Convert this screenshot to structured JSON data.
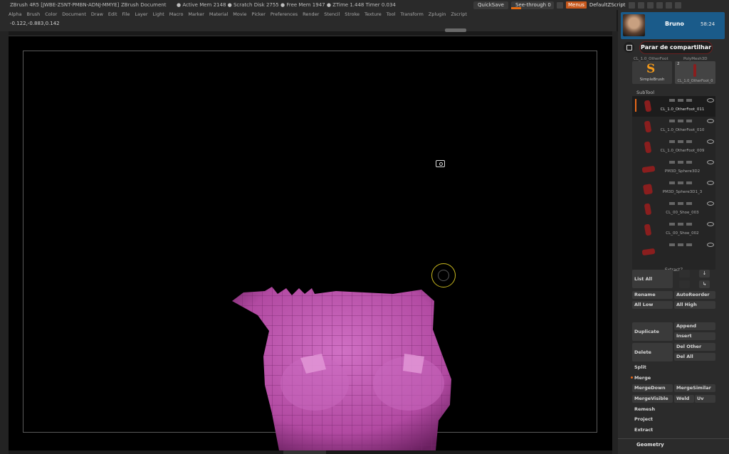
{
  "title_bar": {
    "app": "ZBrush 4R5 [JWBE-ZSNT-PMBN-ADNJ-MMYE]",
    "document": "ZBrush Document",
    "stats": "● Active Mem 2148 ● Scratch Disk 2755 ● Free Mem 1947 ● ZTime 1.448 Timer 0.034",
    "quicksave": "QuickSave",
    "see_through": "See-through",
    "see_through_value": "0",
    "menus": "Menus",
    "script": "DefaultZScript"
  },
  "menu_bar": {
    "items": [
      "Alpha",
      "Brush",
      "Color",
      "Document",
      "Draw",
      "Edit",
      "File",
      "Layer",
      "Light",
      "Macro",
      "Marker",
      "Material",
      "Movie",
      "Picker",
      "Preferences",
      "Render",
      "Stencil",
      "Stroke",
      "Texture",
      "Tool",
      "Transform",
      "Zplugin",
      "Zscript"
    ]
  },
  "coords": "-0.122,-0.883,0.142",
  "user": {
    "name": "Bruno",
    "time": "58:24"
  },
  "share_button": "Parar de compartilhar",
  "brushes": {
    "label_1": "CL_1.0_OtherFoot",
    "label_2": "PolyMesh3D",
    "simple_brush": "SimpleBrush",
    "brush2_count": "2",
    "brush2_name": "CL_1.0_OtherFoot_0"
  },
  "subtool": {
    "header": "SubTool",
    "items": [
      {
        "label": "CL_1.0_OtherFoot_011"
      },
      {
        "label": "CL_1.0_OtherFoot_010"
      },
      {
        "label": "CL_1.0_OtherFoot_009"
      },
      {
        "label": "PM3D_Sphere3D2"
      },
      {
        "label": "PM3D_Sphere3D1_3"
      },
      {
        "label": "CL_00_Shoe_003"
      },
      {
        "label": "CL_00_Shoe_002"
      },
      {
        "label": ""
      }
    ],
    "extract_label": "Extract7"
  },
  "buttons": {
    "list_all": "List All",
    "rename": "Rename",
    "auto_reorder": "AutoReorder",
    "all_low": "All Low",
    "all_high": "All High",
    "duplicate": "Duplicate",
    "append": "Append",
    "insert": "Insert",
    "delete": "Delete",
    "del_other": "Del Other",
    "del_all": "Del All",
    "split": "Split",
    "merge": "Merge",
    "merge_down": "MergeDown",
    "merge_similar": "MergeSimilar",
    "merge_visible": "MergeVisible",
    "weld": "Weld",
    "uv": "Uv",
    "remesh": "Remesh",
    "project": "Project",
    "extract": "Extract",
    "geometry": "Geometry"
  },
  "colors": {
    "accent": "#e8681a",
    "user_box": "#1a5b8a",
    "mesh": "#c25ab0"
  }
}
